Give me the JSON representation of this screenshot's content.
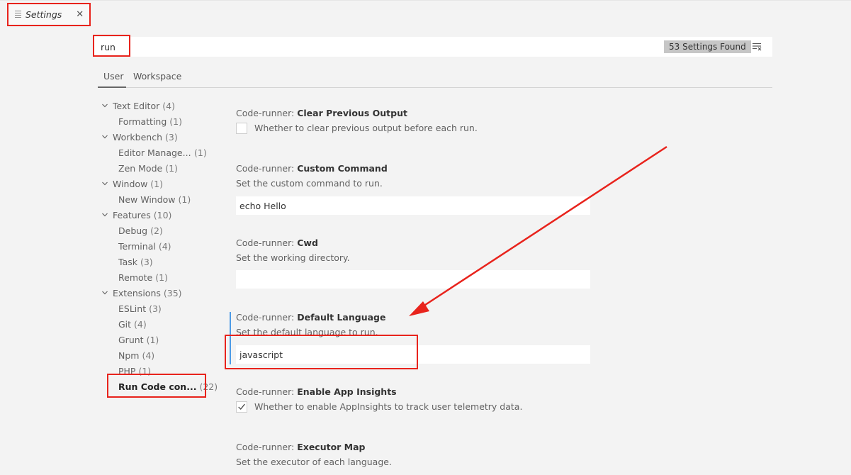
{
  "tab": {
    "label": "Settings",
    "close_glyph": "✕"
  },
  "search": {
    "value": "run",
    "results_label": "53 Settings Found"
  },
  "scopes": [
    {
      "label": "User"
    },
    {
      "label": "Workspace"
    }
  ],
  "toc": [
    {
      "label": "Text Editor",
      "count": "(4)"
    },
    {
      "label": "Formatting",
      "count": "(1)"
    },
    {
      "label": "Workbench",
      "count": "(3)"
    },
    {
      "label": "Editor Manage...",
      "count": "(1)"
    },
    {
      "label": "Zen Mode",
      "count": "(1)"
    },
    {
      "label": "Window",
      "count": "(1)"
    },
    {
      "label": "New Window",
      "count": "(1)"
    },
    {
      "label": "Features",
      "count": "(10)"
    },
    {
      "label": "Debug",
      "count": "(2)"
    },
    {
      "label": "Terminal",
      "count": "(4)"
    },
    {
      "label": "Task",
      "count": "(3)"
    },
    {
      "label": "Remote",
      "count": "(1)"
    },
    {
      "label": "Extensions",
      "count": "(35)"
    },
    {
      "label": "ESLint",
      "count": "(3)"
    },
    {
      "label": "Git",
      "count": "(4)"
    },
    {
      "label": "Grunt",
      "count": "(1)"
    },
    {
      "label": "Npm",
      "count": "(4)"
    },
    {
      "label": "PHP",
      "count": "(1)"
    },
    {
      "label": "Run Code con...",
      "count": "(22)"
    }
  ],
  "settings": [
    {
      "prefix": "Code-runner: ",
      "name": "Clear Previous Output",
      "description": "Whether to clear previous output before each run.",
      "checked": false
    },
    {
      "prefix": "Code-runner: ",
      "name": "Custom Command",
      "description": "Set the custom command to run.",
      "value": "echo Hello"
    },
    {
      "prefix": "Code-runner: ",
      "name": "Cwd",
      "description": "Set the working directory.",
      "value": ""
    },
    {
      "prefix": "Code-runner: ",
      "name": "Default Language",
      "description": "Set the default language to run.",
      "value": "javascript"
    },
    {
      "prefix": "Code-runner: ",
      "name": "Enable App Insights",
      "description": "Whether to enable AppInsights to track user telemetry data.",
      "checked": true
    },
    {
      "prefix": "Code-runner: ",
      "name": "Executor Map",
      "description": "Set the executor of each language."
    }
  ],
  "colors": {
    "annotation_red": "#e8231c",
    "focus_blue": "#4d9be6"
  },
  "icons": {
    "tab_icon": "lines-icon",
    "clear_filter": "clear-filter-icon",
    "expand": "chevron-down-icon",
    "check": "check-icon"
  }
}
